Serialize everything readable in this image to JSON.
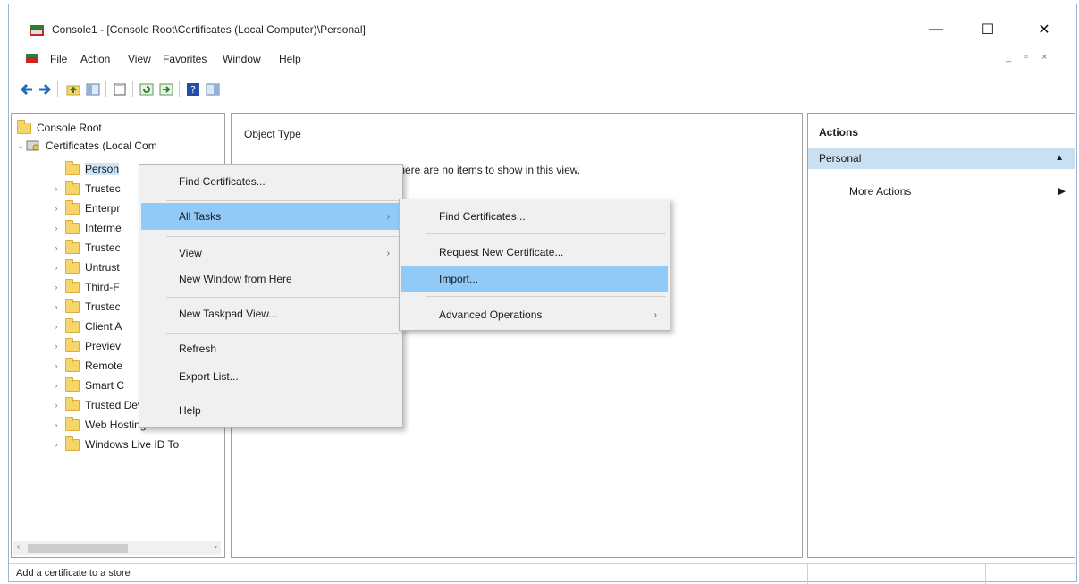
{
  "window": {
    "title": "Console1 - [Console Root\\Certificates (Local Computer)\\Personal]",
    "controls": {
      "minimize": "—",
      "maximize": "☐",
      "close": "✕"
    }
  },
  "menubar": {
    "items": [
      "File",
      "Action",
      "View",
      "Favorites",
      "Window",
      "Help"
    ],
    "mdi_controls": "_ ▫ ×"
  },
  "tree": {
    "root": "Console Root",
    "certificates": "Certificates (Local Com",
    "items": [
      {
        "label": "Person",
        "selected": true
      },
      {
        "label": "Trustec"
      },
      {
        "label": "Enterpr"
      },
      {
        "label": "Interme"
      },
      {
        "label": "Trustec"
      },
      {
        "label": "Untrust"
      },
      {
        "label": "Third-F"
      },
      {
        "label": "Trustec"
      },
      {
        "label": "Client A"
      },
      {
        "label": "Previev"
      },
      {
        "label": "Remote"
      },
      {
        "label": "Smart C"
      },
      {
        "label": "Trusted Devices"
      },
      {
        "label": "Web Hosting"
      },
      {
        "label": "Windows Live ID To"
      }
    ]
  },
  "center": {
    "column_header": "Object Type",
    "empty_message": "There are no items to show in this view."
  },
  "actions": {
    "header": "Actions",
    "section": "Personal",
    "more_actions": "More Actions"
  },
  "context_menu": {
    "items": [
      {
        "label": "Find Certificates..."
      },
      {
        "label": "All Tasks",
        "submenu": true,
        "highlighted": true
      },
      {
        "label": "View",
        "submenu": true
      },
      {
        "label": "New Window from Here"
      },
      {
        "label": "New Taskpad View..."
      },
      {
        "label": "Refresh"
      },
      {
        "label": "Export List..."
      },
      {
        "label": "Help"
      }
    ]
  },
  "submenu": {
    "items": [
      {
        "label": "Find Certificates..."
      },
      {
        "label": "Request New Certificate..."
      },
      {
        "label": "Import...",
        "highlighted": true
      },
      {
        "label": "Advanced Operations",
        "submenu": true
      }
    ]
  },
  "statusbar": {
    "text": "Add a certificate to a store"
  },
  "colors": {
    "selection_highlight": "#91c9f7",
    "actions_section_bg": "#c9dff2",
    "folder": "#f6d66b"
  }
}
